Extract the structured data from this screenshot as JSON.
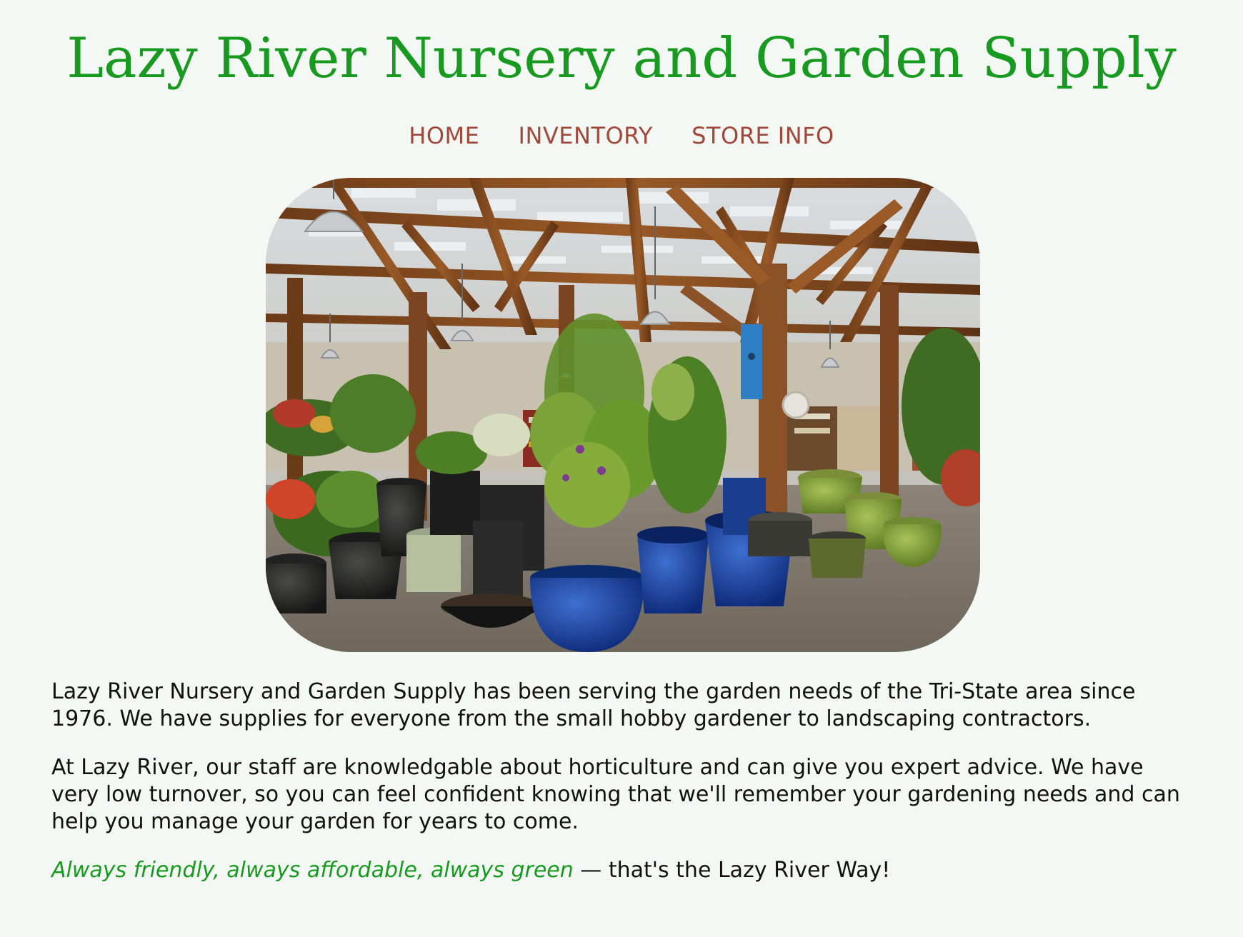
{
  "header": {
    "title": "Lazy River Nursery and Garden Supply"
  },
  "nav": {
    "items": [
      {
        "label": "HOME"
      },
      {
        "label": "INVENTORY"
      },
      {
        "label": "STORE INFO"
      }
    ]
  },
  "hero": {
    "alt": "Interior of the Lazy River Nursery garden center with wooden beams and potted plants"
  },
  "content": {
    "paragraph1": "Lazy River Nursery and Garden Supply has been serving the garden needs of the Tri-State area since 1976. We have supplies for everyone from the small hobby gardener to landscaping contractors.",
    "paragraph2": "At Lazy River, our staff are knowledgable about horticulture and can give you expert advice. We have very low turnover, so you can feel confident knowing that we'll remember your gardening needs and can help you manage your garden for years to come.",
    "motto": "Always friendly, always affordable, always green",
    "motto_suffix": " — that's the Lazy River Way!"
  },
  "colors": {
    "background": "#f3f8f4",
    "title_green": "#179a1f",
    "nav_link": "#a0483a",
    "text": "#111111"
  }
}
